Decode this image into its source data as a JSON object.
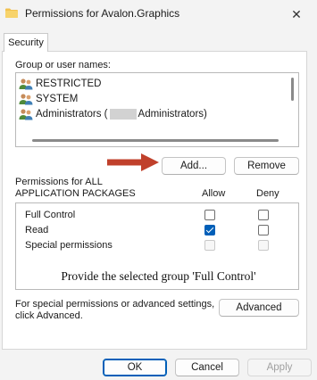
{
  "window": {
    "title": "Permissions for Avalon.Graphics",
    "close_glyph": "✕",
    "folder_icon": "folder-icon",
    "folder_color": "#f2c14e"
  },
  "tabs": [
    {
      "label": "Security"
    }
  ],
  "groups": {
    "label": "Group or user names:",
    "items": [
      {
        "name": "RESTRICTED"
      },
      {
        "name": "SYSTEM"
      },
      {
        "name_prefix": "Administrators (",
        "name_suffix": "Administrators)"
      }
    ]
  },
  "group_buttons": {
    "add": "Add...",
    "remove": "Remove"
  },
  "permissions": {
    "label_line1": "Permissions for ALL",
    "label_line2": "APPLICATION PACKAGES",
    "allow_header": "Allow",
    "deny_header": "Deny",
    "rows": [
      {
        "name": "Full Control",
        "allow": false,
        "deny": false,
        "enabled": true
      },
      {
        "name": "Read",
        "allow": true,
        "deny": false,
        "enabled": true
      },
      {
        "name": "Special permissions",
        "allow": false,
        "deny": false,
        "enabled": false
      }
    ]
  },
  "instruction": "Provide the selected group 'Full Control'",
  "advanced": {
    "text_line1": "For special permissions or advanced settings,",
    "text_line2": "click Advanced.",
    "button": "Advanced"
  },
  "footer": {
    "ok": "OK",
    "cancel": "Cancel",
    "apply": "Apply"
  },
  "colors": {
    "accent": "#005fb8",
    "arrow": "#c0402b"
  }
}
